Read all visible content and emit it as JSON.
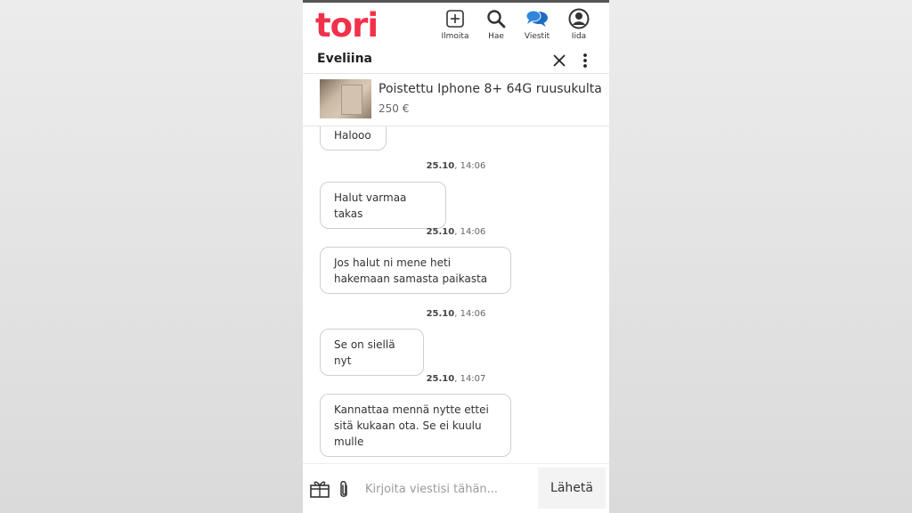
{
  "header": {
    "logo": "tori",
    "nav": [
      {
        "icon": "plus-square-icon",
        "label": "Ilmoita"
      },
      {
        "icon": "search-icon",
        "label": "Hae"
      },
      {
        "icon": "chat-bubbles-icon",
        "label": "Viestit"
      },
      {
        "icon": "user-icon",
        "label": "Iida"
      }
    ]
  },
  "conversation": {
    "name": "Eveliina",
    "close_icon": "close-icon",
    "more_icon": "more-vertical-icon"
  },
  "product": {
    "title": "Poistettu Iphone 8+ 64G ruusukulta",
    "price": "250 €"
  },
  "messages": [
    {
      "text": "Halooo",
      "date": "",
      "time": ""
    },
    {
      "text": "Halut varmaa takas",
      "date": "25.10",
      "time": ", 14:06"
    },
    {
      "text": "Jos halut ni mene heti hakemaan samasta paikasta",
      "date": "25.10",
      "time": ", 14:06"
    },
    {
      "text": "Se on siellä nyt",
      "date": "25.10",
      "time": ", 14:06"
    },
    {
      "text": "Kannattaa mennä nytte ettei sitä kukaan ota. Se ei kuulu mulle",
      "date": "25.10",
      "time": ", 14:07"
    }
  ],
  "composer": {
    "placeholder": "Kirjoita viestisi tähän...",
    "send_label": "Lähetä",
    "gift_icon": "gift-icon",
    "attach_icon": "paperclip-icon"
  },
  "colors": {
    "brand": "#f1304a",
    "active_nav": "#1d6ec2",
    "bubble_border": "#cfcfcf"
  }
}
